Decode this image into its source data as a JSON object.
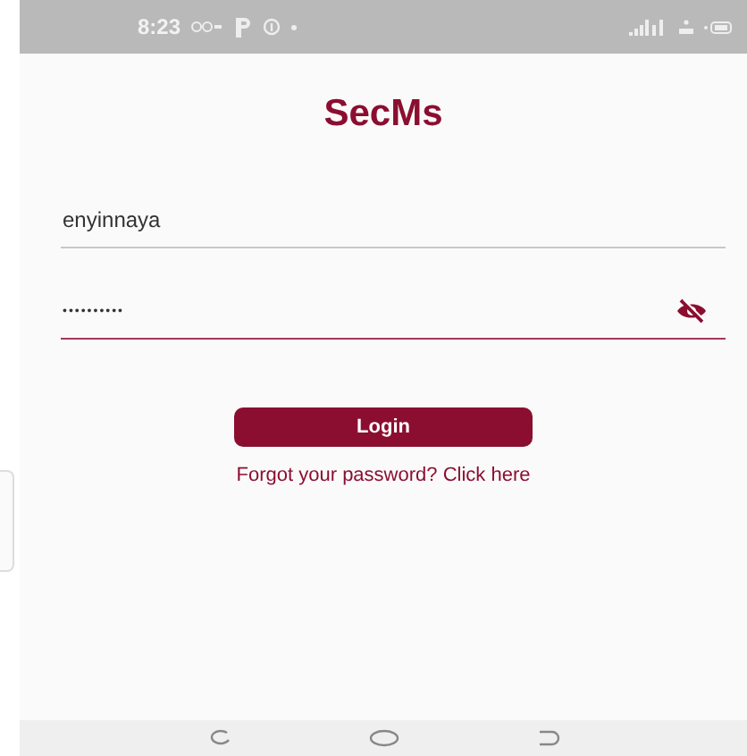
{
  "status_bar": {
    "time": "8:23"
  },
  "app": {
    "title": "SecMs"
  },
  "username": {
    "value": "enyinnaya",
    "focused": false
  },
  "password": {
    "value": "••••••••••",
    "focused": true,
    "visible": false
  },
  "login_button": {
    "label": "Login"
  },
  "forgot_link": {
    "label": "Forgot your password? Click here"
  }
}
